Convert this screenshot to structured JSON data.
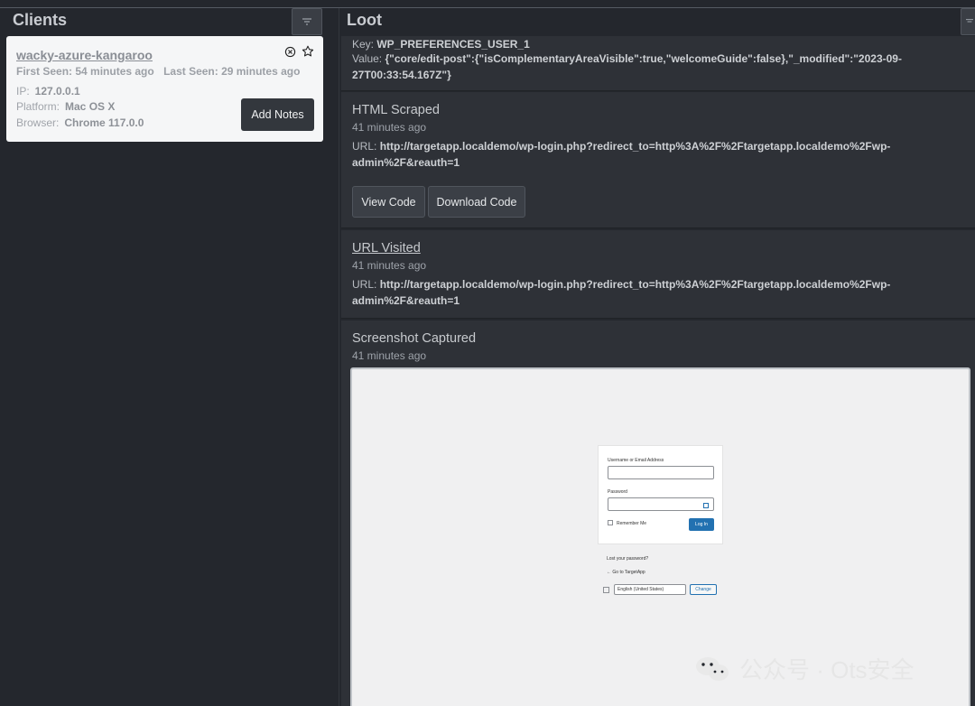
{
  "clients_panel": {
    "title": "Clients",
    "client": {
      "name": "wacky-azure-kangaroo",
      "first_seen": "First Seen: 54 minutes ago",
      "last_seen": "Last Seen: 29 minutes ago",
      "ip_label": "IP:",
      "ip": "127.0.0.1",
      "platform_label": "Platform:",
      "platform": "Mac OS X",
      "browser_label": "Browser:",
      "browser": "Chrome 117.0.0",
      "add_notes_label": "Add Notes"
    }
  },
  "loot_panel": {
    "title": "Loot",
    "preferences": {
      "key_label": "Key:",
      "key": "WP_PREFERENCES_USER_1",
      "value_label": "Value:",
      "value_line1": "{\"core/edit-post\":{\"isComplementaryAreaVisible\":true,\"welcomeGuide\":false},\"_modified\":\"2023-09-",
      "value_line2": "27T00:33:54.167Z\"}"
    },
    "html_scraped": {
      "title": "HTML Scraped",
      "time": "41 minutes ago",
      "url_label": "URL:",
      "url_line1": "http://targetapp.localdemo/wp-login.php?redirect_to=http%3A%2F%2Ftargetapp.localdemo%2Fwp-",
      "url_line2": "admin%2F&reauth=1",
      "view_code_label": "View Code",
      "download_code_label": "Download Code"
    },
    "url_visited": {
      "title": "URL Visited",
      "time": "41 minutes ago",
      "url_label": "URL:",
      "url_line1": "http://targetapp.localdemo/wp-login.php?redirect_to=http%3A%2F%2Ftargetapp.localdemo%2Fwp-",
      "url_line2": "admin%2F&reauth=1"
    },
    "screenshot": {
      "title": "Screenshot Captured",
      "time": "41 minutes ago",
      "login": {
        "username_label": "Username or Email Address",
        "password_label": "Password",
        "remember_label": "Remember Me",
        "login_button": "Log In",
        "lost_password": "Lost your password?",
        "go_to": "← Go to TargetApp",
        "language": "English (United States)",
        "change_button": "Change"
      }
    }
  },
  "watermark": {
    "text": "公众号 · Ots安全"
  }
}
